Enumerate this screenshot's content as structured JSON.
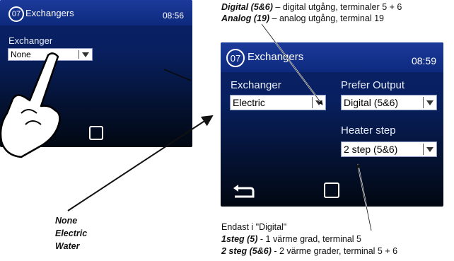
{
  "screen_left": {
    "number": "07",
    "title": "Exchangers",
    "time": "08:56",
    "exchanger_label": "Exchanger",
    "exchanger_value": "None"
  },
  "screen_right": {
    "number": "07",
    "title": "Exchangers",
    "time": "08:59",
    "exchanger_label": "Exchanger",
    "exchanger_value": "Electric",
    "prefer_output_label": "Prefer Output",
    "prefer_output_value": "Digital (5&6)",
    "heater_step_label": "Heater step",
    "heater_step_value": "2 step (5&6)"
  },
  "notes": {
    "top_line1_bold": "Digital (5&6)",
    "top_line1_rest": " – digital utgång, terminaler 5 + 6",
    "top_line2_bold": "Analog (19)",
    "top_line2_rest": " – analog utgång, terminal 19",
    "options": [
      "None",
      "Electric",
      "Water"
    ],
    "bottom_line1": "Endast i \"Digital\"",
    "bottom_line2_bold": "1steg (5)",
    "bottom_line2_rest": " - 1 värme grad, terminal 5",
    "bottom_line3_bold": "2 steg (5&6)",
    "bottom_line3_rest": " - 2 värme grader, terminal 5 + 6"
  },
  "colors": {
    "screen_top": "#0a1f66",
    "screen_bottom": "#020812",
    "titlebar": "#1c3a9a"
  },
  "icons": [
    "hand-pointer-icon",
    "back-arrow-icon",
    "home-icon",
    "dropdown-arrow-icon"
  ]
}
